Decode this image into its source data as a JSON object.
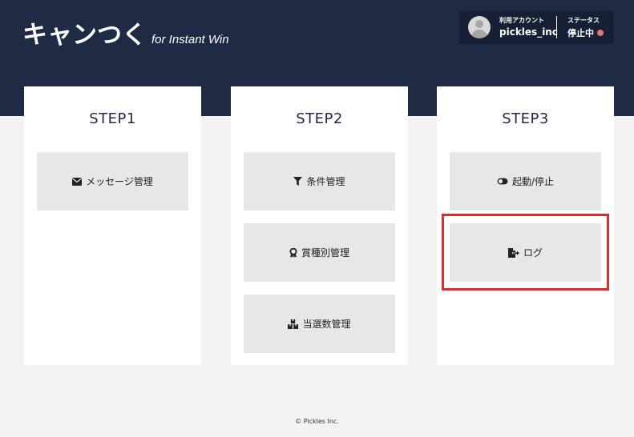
{
  "header": {
    "logo_main": "キャンつく",
    "logo_sub": "for Instant Win",
    "account_label": "利用アカウント",
    "account_name": "pickles_inc",
    "status_label": "ステータス",
    "status_value": "停止中",
    "status_color": "#e8727c",
    "background_color": "#1f2b45"
  },
  "steps": [
    {
      "title": "STEP1",
      "buttons": [
        {
          "label": "メッセージ管理",
          "icon": "envelope-icon"
        }
      ]
    },
    {
      "title": "STEP2",
      "buttons": [
        {
          "label": "条件管理",
          "icon": "filter-icon"
        },
        {
          "label": "賞種別管理",
          "icon": "award-icon"
        },
        {
          "label": "当選数管理",
          "icon": "boxes-icon"
        }
      ]
    },
    {
      "title": "STEP3",
      "buttons": [
        {
          "label": "起動/停止",
          "icon": "toggle-icon"
        },
        {
          "label": "ログ",
          "icon": "file-export-icon"
        }
      ]
    }
  ],
  "highlight_color": "#e5282a",
  "footer": {
    "copyright": "© Pickles Inc."
  }
}
